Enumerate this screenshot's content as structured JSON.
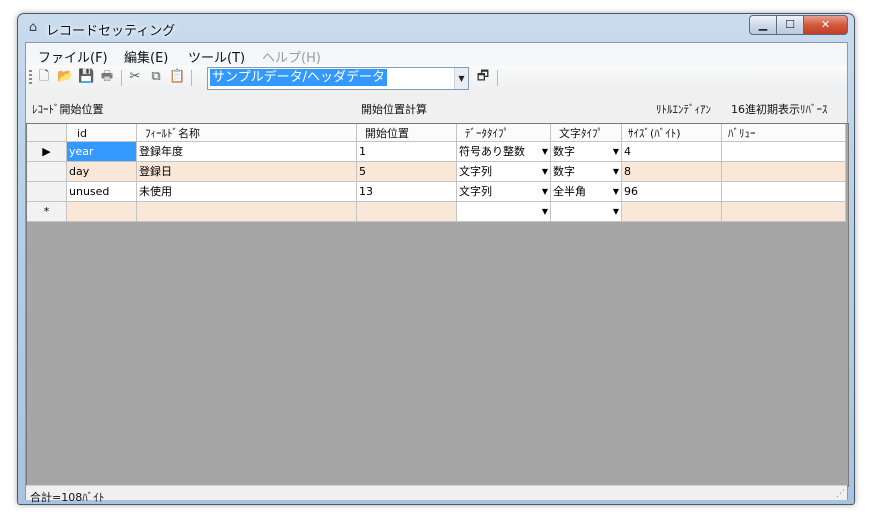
{
  "window": {
    "title": "レコードセッティング"
  },
  "menu": [
    "ファイル(F)",
    "編集(E)",
    "ツール(T)",
    "ヘルプ(H)"
  ],
  "toolbar": {
    "combo_value": "サンプルデータ/ヘッダデータ",
    "record_start_label": "ﾚｺｰﾄﾞ開始位置",
    "start_calc_label": "開始位置計算",
    "little_endian_label": "ﾘﾄﾙｴﾝﾃﾞｨｱﾝ",
    "hex_reverse_label": "16進初期表示ﾘﾊﾞｰｽ"
  },
  "grid": {
    "columns": [
      "id",
      "ﾌｨｰﾙﾄﾞ名称",
      "開始位置",
      "ﾃﾞｰﾀﾀｲﾌﾟ",
      "文字ﾀｲﾌﾟ",
      "ｻｲｽﾞ(ﾊﾞｲﾄ)",
      "ﾊﾞﾘｭｰ"
    ],
    "rows": [
      {
        "marker": "▶",
        "id": "year",
        "name": "登録年度",
        "start": "1",
        "data_type": "符号あり整数",
        "char_type": "数字",
        "size": "4",
        "value": ""
      },
      {
        "marker": "",
        "id": "day",
        "name": "登録日",
        "start": "5",
        "data_type": "文字列",
        "char_type": "数字",
        "size": "8",
        "value": ""
      },
      {
        "marker": "",
        "id": "unused",
        "name": "未使用",
        "start": "13",
        "data_type": "文字列",
        "char_type": "全半角",
        "size": "96",
        "value": ""
      }
    ],
    "new_row_marker": "*"
  },
  "status": {
    "text": "合計=108ﾊﾞｲﾄ"
  }
}
